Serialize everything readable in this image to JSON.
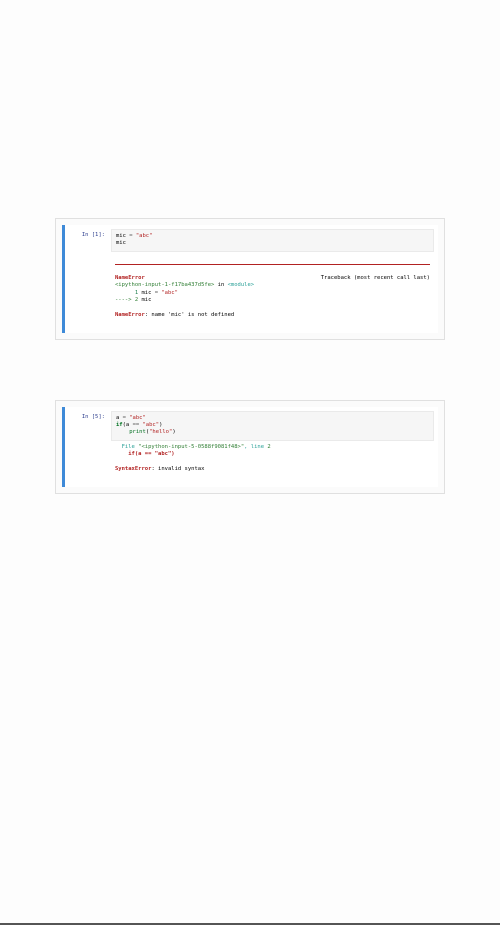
{
  "cells": [
    {
      "prompt": "In [1]:",
      "input": {
        "l1": {
          "a": "mic",
          "b": " = ",
          "c": "\"abc\""
        },
        "l2": "mic"
      },
      "output": {
        "err_name": "NameError",
        "traceback_label": "Traceback (most recent call last)",
        "loc": "<ipython-input-1-f17ba437d5fe>",
        "in_kw": " in ",
        "module": "<module>",
        "line1": {
          "num": "      1 ",
          "a": "mic",
          "b": " = ",
          "c": "\"abc\""
        },
        "line2": {
          "arrow": "----> 2 ",
          "a": "mic"
        },
        "final_err": "NameError",
        "final_msg": ": name 'mic' is not defined"
      }
    },
    {
      "prompt": "In [5]:",
      "input": {
        "l1": {
          "a": "a",
          "b": " = ",
          "c": "\"abc\""
        },
        "l2": {
          "a": "if",
          "b": "(a ",
          "c": "==",
          "d": " ",
          "e": "\"abc\"",
          "f": ")"
        },
        "l3": {
          "a": "    ",
          "b": "print",
          "c": "(",
          "d": "\"hello\"",
          "e": ")"
        }
      },
      "output": {
        "file_label": "  File ",
        "file_loc": "\"<ipython-input-5-0588f9081f48>\"",
        "file_line": ", line ",
        "file_lineno": "2",
        "offending": "    if(a == \"abc\")",
        "caret": "                  ",
        "final_err": "SyntaxError",
        "final_msg": ": invalid syntax"
      }
    }
  ]
}
